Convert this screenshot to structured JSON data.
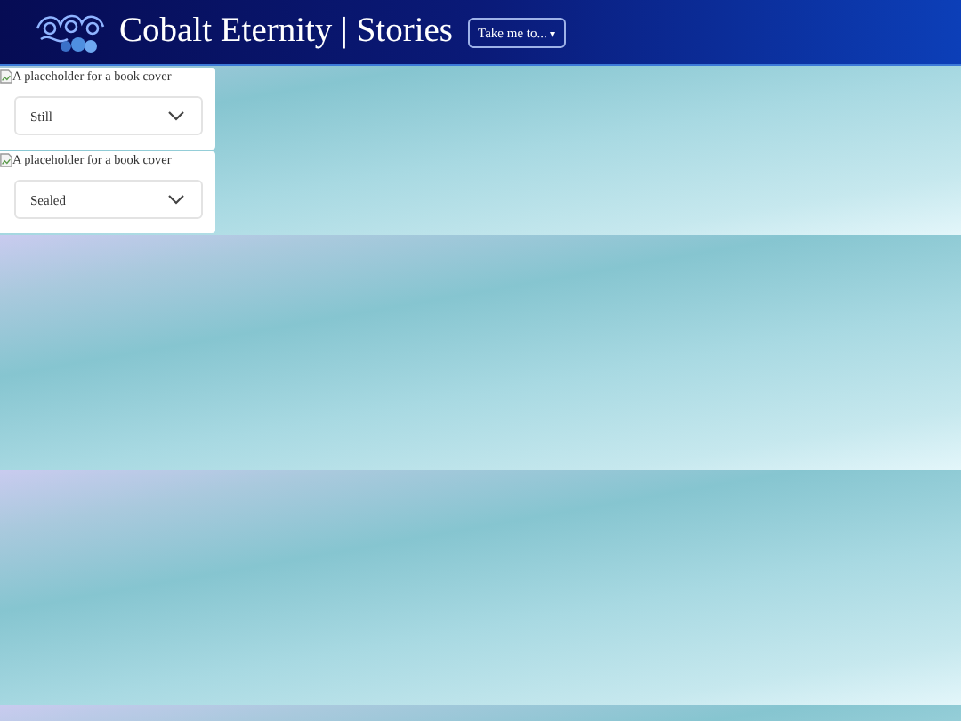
{
  "header": {
    "title": "Cobalt Eternity | Stories",
    "nav_button": {
      "label": "Take me to...",
      "caret": "▾"
    }
  },
  "stories": [
    {
      "cover_alt": "A placeholder for a book cover",
      "status": "Still"
    },
    {
      "cover_alt": "A placeholder for a book cover",
      "status": "Sealed"
    }
  ]
}
